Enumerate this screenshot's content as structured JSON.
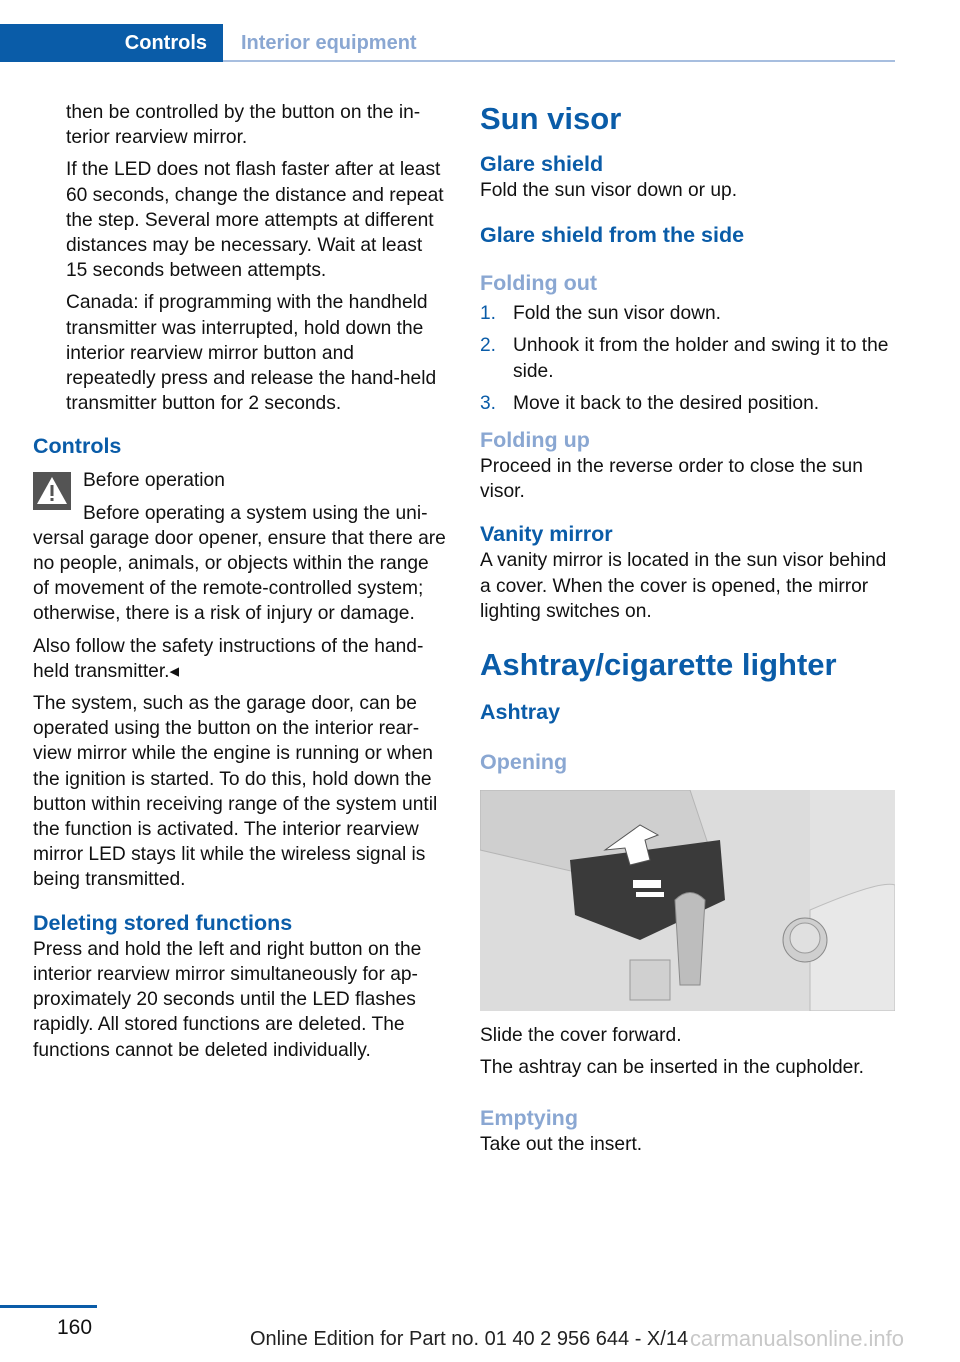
{
  "header": {
    "section": "Controls",
    "subsection": "Interior equipment"
  },
  "left": {
    "p1": "then be controlled by the button on the in­terior rearview mirror.",
    "p2": "If the LED does not flash faster after at least 60 seconds, change the distance and repeat the step. Several more attempts at different distances may be necessary. Wait at least 15 seconds between attempts.",
    "p3": "Canada: if programming with the hand­held transmitter was interrupted, hold down the interior rearview mirror button and repeatedly press and release the hand-held transmitter button for 2 sec­onds.",
    "controls_heading": "Controls",
    "warning_title": "Before operation",
    "warning_text": "Before operating a system using the uni­versal garage door opener, ensure that there are no people, animals, or objects within the range of movement of the remote-controlled system; otherwise, there is a risk of injury or damage.",
    "warning_follow": "Also follow the safety instructions of the hand­held transmitter.◂",
    "p4": "The system, such as the garage door, can be operated using the button on the interior rear­view mirror while the engine is running or when the ignition is started. To do this, hold down the button within receiving range of the system until the function is activated. The interior rear­view mirror LED stays lit while the wireless sig­nal is being transmitted.",
    "deleting_heading": "Deleting stored functions",
    "p5": "Press and hold the left and right button on the interior rearview mirror simultaneously for ap­proximately 20 seconds until the LED flashes rapidly. All stored functions are deleted. The functions cannot be deleted individually."
  },
  "right": {
    "sun_visor": "Sun visor",
    "glare_shield": "Glare shield",
    "glare_text": "Fold the sun visor down or up.",
    "glare_side": "Glare shield from the side",
    "folding_out": "Folding out",
    "steps": [
      {
        "num": "1.",
        "text": "Fold the sun visor down."
      },
      {
        "num": "2.",
        "text": "Unhook it from the holder and swing it to the side."
      },
      {
        "num": "3.",
        "text": "Move it back to the desired position."
      }
    ],
    "folding_up": "Folding up",
    "folding_up_text": "Proceed in the reverse order to close the sun visor.",
    "vanity_mirror": "Vanity mirror",
    "vanity_text": "A vanity mirror is located in the sun visor be­hind a cover. When the cover is opened, the mirror lighting switches on.",
    "ashtray_lighter": "Ashtray/cigarette lighter",
    "ashtray": "Ashtray",
    "opening": "Opening",
    "slide_text": "Slide the cover forward.",
    "cupholder_text": "The ashtray can be inserted in the cupholder.",
    "emptying": "Emptying",
    "emptying_text": "Take out the insert."
  },
  "footer": {
    "page_number": "160",
    "edition": "Online Edition for Part no. 01 40 2 956 644 - X/14",
    "watermark": "carmanualsonline.info"
  },
  "colors": {
    "accent": "#0a5ca8",
    "subheading": "#8aa7d2"
  }
}
